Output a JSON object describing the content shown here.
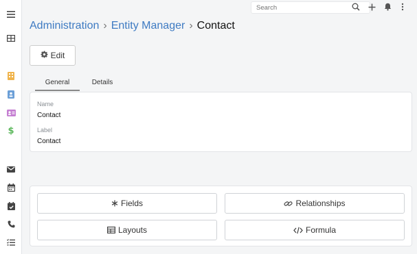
{
  "topbar": {
    "search_placeholder": "Search",
    "icons": [
      "search-icon",
      "plus-icon",
      "bell-icon",
      "more-vertical-icon"
    ]
  },
  "sidebar": {
    "icons": [
      "menu-icon",
      "grid-icon",
      "building-icon",
      "contact-card-icon",
      "id-card-icon",
      "dollar-icon",
      "envelope-icon",
      "calendar-icon",
      "calendar-check-icon",
      "phone-icon",
      "tasks-icon"
    ],
    "colors": {
      "building": "#f0b44c",
      "contact": "#6b9fd7",
      "idcard": "#c57fd2",
      "dollar": "#5cb85c",
      "neutral": "#444444"
    }
  },
  "breadcrumb": {
    "items": [
      {
        "label": "Administration"
      },
      {
        "label": "Entity Manager"
      }
    ],
    "separator": "›",
    "current": "Contact"
  },
  "toolbar": {
    "edit_label": "Edit",
    "edit_icon": "gear-icon"
  },
  "tabs": [
    {
      "label": "General",
      "active": true
    },
    {
      "label": "Details",
      "active": false
    }
  ],
  "fields": [
    {
      "label": "Name",
      "value": "Contact"
    },
    {
      "label": "Label",
      "value": "Contact"
    }
  ],
  "actions": [
    {
      "label": "Fields",
      "icon": "asterisk-icon"
    },
    {
      "label": "Relationships",
      "icon": "link-icon"
    },
    {
      "label": "Layouts",
      "icon": "table-icon"
    },
    {
      "label": "Formula",
      "icon": "code-icon"
    }
  ],
  "colors": {
    "link": "#3d7ac2",
    "background": "#f4f5f6"
  }
}
